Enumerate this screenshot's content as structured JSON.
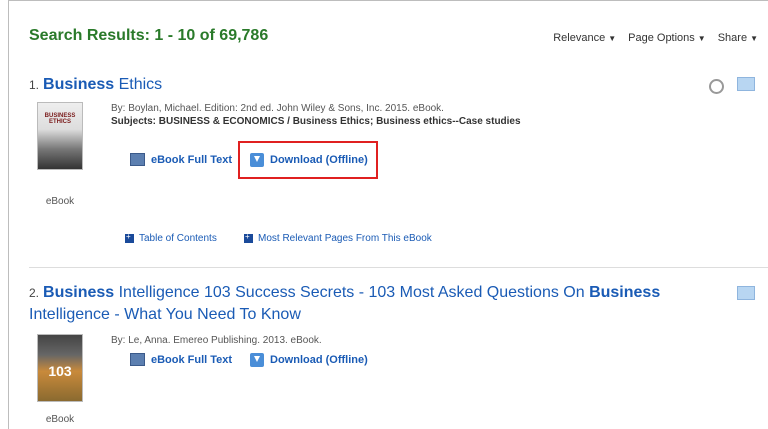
{
  "header": {
    "results_title": "Search Results: 1 - 10 of 69,786",
    "sort_label": "Relevance",
    "page_options_label": "Page Options",
    "share_label": "Share"
  },
  "results": [
    {
      "number": "1.",
      "title_bold": "Business",
      "title_rest": " Ethics",
      "byline": "By: Boylan, Michael. Edition: 2nd ed. John Wiley & Sons, Inc. 2015. eBook.",
      "subjects_label": "Subjects:",
      "subjects": "BUSINESS & ECONOMICS / Business Ethics; Business ethics--Case studies",
      "cover_text": "BUSINESS ETHICS",
      "type_label": "eBook",
      "fulltext_label": "eBook Full Text",
      "download_label": "Download (Offline)",
      "toc_label": "Table of Contents",
      "relevant_label": "Most Relevant Pages From This eBook"
    },
    {
      "number": "2.",
      "title_part1_bold": "Business",
      "title_part2": " Intelligence 103 Success Secrets - 103 Most Asked Questions On ",
      "title_part3_bold": "Business",
      "title_part4": "Intelligence - What You Need To Know",
      "byline": "By: Le, Anna. Emereo Publishing. 2013. eBook.",
      "cover_text": "103",
      "type_label": "eBook",
      "fulltext_label": "eBook Full Text",
      "download_label": "Download (Offline)"
    }
  ]
}
